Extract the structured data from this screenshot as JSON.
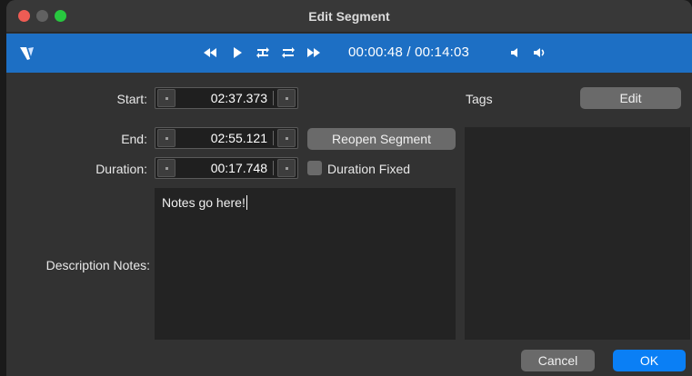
{
  "window": {
    "title": "Edit Segment"
  },
  "toolbar": {
    "logo_icon": "app-logo-icon",
    "timecode": "00:00:48 / 00:14:03",
    "buttons": [
      "rewind-icon",
      "play-icon",
      "loop-a-icon",
      "loop-b-icon",
      "fast-forward-icon",
      "volume-down-icon",
      "volume-up-icon"
    ]
  },
  "form": {
    "start_label": "Start:",
    "start_value": "02:37.373",
    "end_label": "End:",
    "end_value": "02:55.121",
    "reopen_button": "Reopen Segment",
    "duration_label": "Duration:",
    "duration_value": "00:17.748",
    "duration_fixed_label": "Duration Fixed",
    "duration_fixed_checked": false,
    "notes_label": "Description Notes:",
    "notes_value": "Notes go here!"
  },
  "tags": {
    "label": "Tags",
    "edit_button": "Edit"
  },
  "footer": {
    "cancel": "Cancel",
    "ok": "OK"
  },
  "colors": {
    "toolbar": "#1d6fc4",
    "primary": "#0a7ff5",
    "window_bg": "#323232"
  }
}
